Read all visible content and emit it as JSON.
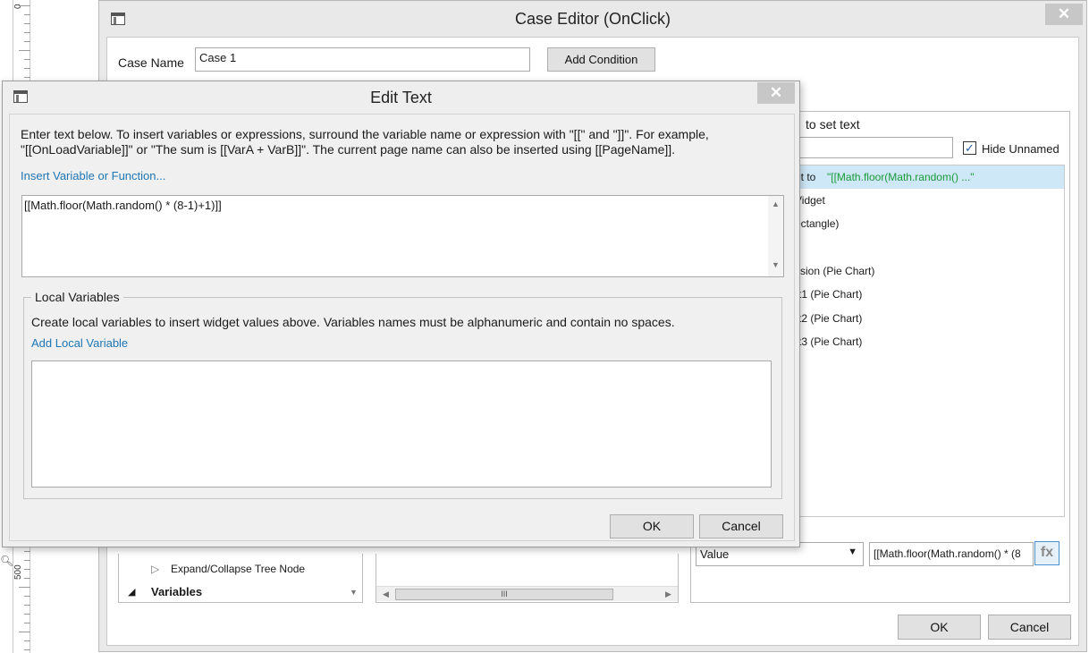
{
  "ruler": {
    "labels": [
      "0",
      "500"
    ]
  },
  "case_editor": {
    "title": "Case Editor (OnClick)",
    "close_label": "✕",
    "case_name_label": "Case Name",
    "case_name_value": "Case 1",
    "add_condition_label": "Add Condition",
    "config_heading": "to set text",
    "hide_unnamed_label": "Hide Unnamed",
    "hide_unnamed_checked": "✓",
    "widget_rows": [
      "et to ",
      "\"[[Math.floor(Math.random() ...\"",
      "Vidget",
      "ectangle)",
      "ssion (Pie Chart)",
      "rt1 (Pie Chart)",
      "rt2 (Pie Chart)",
      "rt3 (Pie Chart)"
    ],
    "actions_tree": {
      "expand_collapse": "Expand/Collapse Tree Node",
      "variables": "Variables"
    },
    "value_select": "Value",
    "value_text": "[[Math.floor(Math.random() * (8",
    "fx_label": "fx",
    "scroll_thumb": "III",
    "ok_label": "OK",
    "cancel_label": "Cancel"
  },
  "edit_text": {
    "title": "Edit Text",
    "close_label": "✕",
    "instruction_line1": "Enter text below. To insert variables or expressions, surround the variable name or expression with \"[[\" and \"]]\". For example,",
    "instruction_line2": "\"[[OnLoadVariable]]\" or \"The sum is [[VarA + VarB]]\". The current page name can also be inserted using [[PageName]].",
    "insert_link": "Insert Variable or Function...",
    "expression": "[[Math.floor(Math.random() * (8-1)+1)]]",
    "local_vars_title": "Local Variables",
    "local_vars_desc": "Create local variables to insert widget values above. Variables names must be alphanumeric and contain no spaces.",
    "add_local_link": "Add Local Variable",
    "ok_label": "OK",
    "cancel_label": "Cancel"
  }
}
